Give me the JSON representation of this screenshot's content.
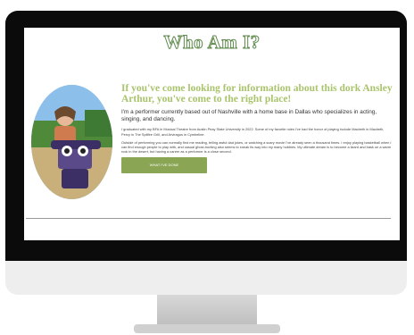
{
  "page": {
    "title": "Who Am I?",
    "headline": "If you've come looking for information about this dork Ansley Arthur, you've come to the right place!",
    "intro": "I'm a performer currently based out of Nashville with a home base in Dallas who specializes in acting, singing, and dancing.",
    "paragraph1": "I graduated with my BFA in Musical Theatre from Austin Peay State University in 2022. Some of my favorite roles I've had the honor of playing include Macbeth in Macbeth, Percy in The Spitfire Grill, and Arviragus in Cymbeline.",
    "paragraph2": "Outside of performing you can normally find me reading, telling awful dad jokes, or watching a scary movie I've already seen a thousand times. I enjoy playing basketball when I can find enough people to play with, and casual ghost-hunting also seems to sneak its way into my many hobbies. My ultimate dream is to become a lizard and bask on a warm rock in the desert, but having a career as a performer is a close second.",
    "cta_label": "WHAT I'VE DONE"
  },
  "colors": {
    "accent_green": "#a9c46c",
    "button_green": "#8aa655",
    "title_outline": "#5f8a4d"
  },
  "photo": {
    "alt": "photo-of-person-with-raven-figure"
  }
}
